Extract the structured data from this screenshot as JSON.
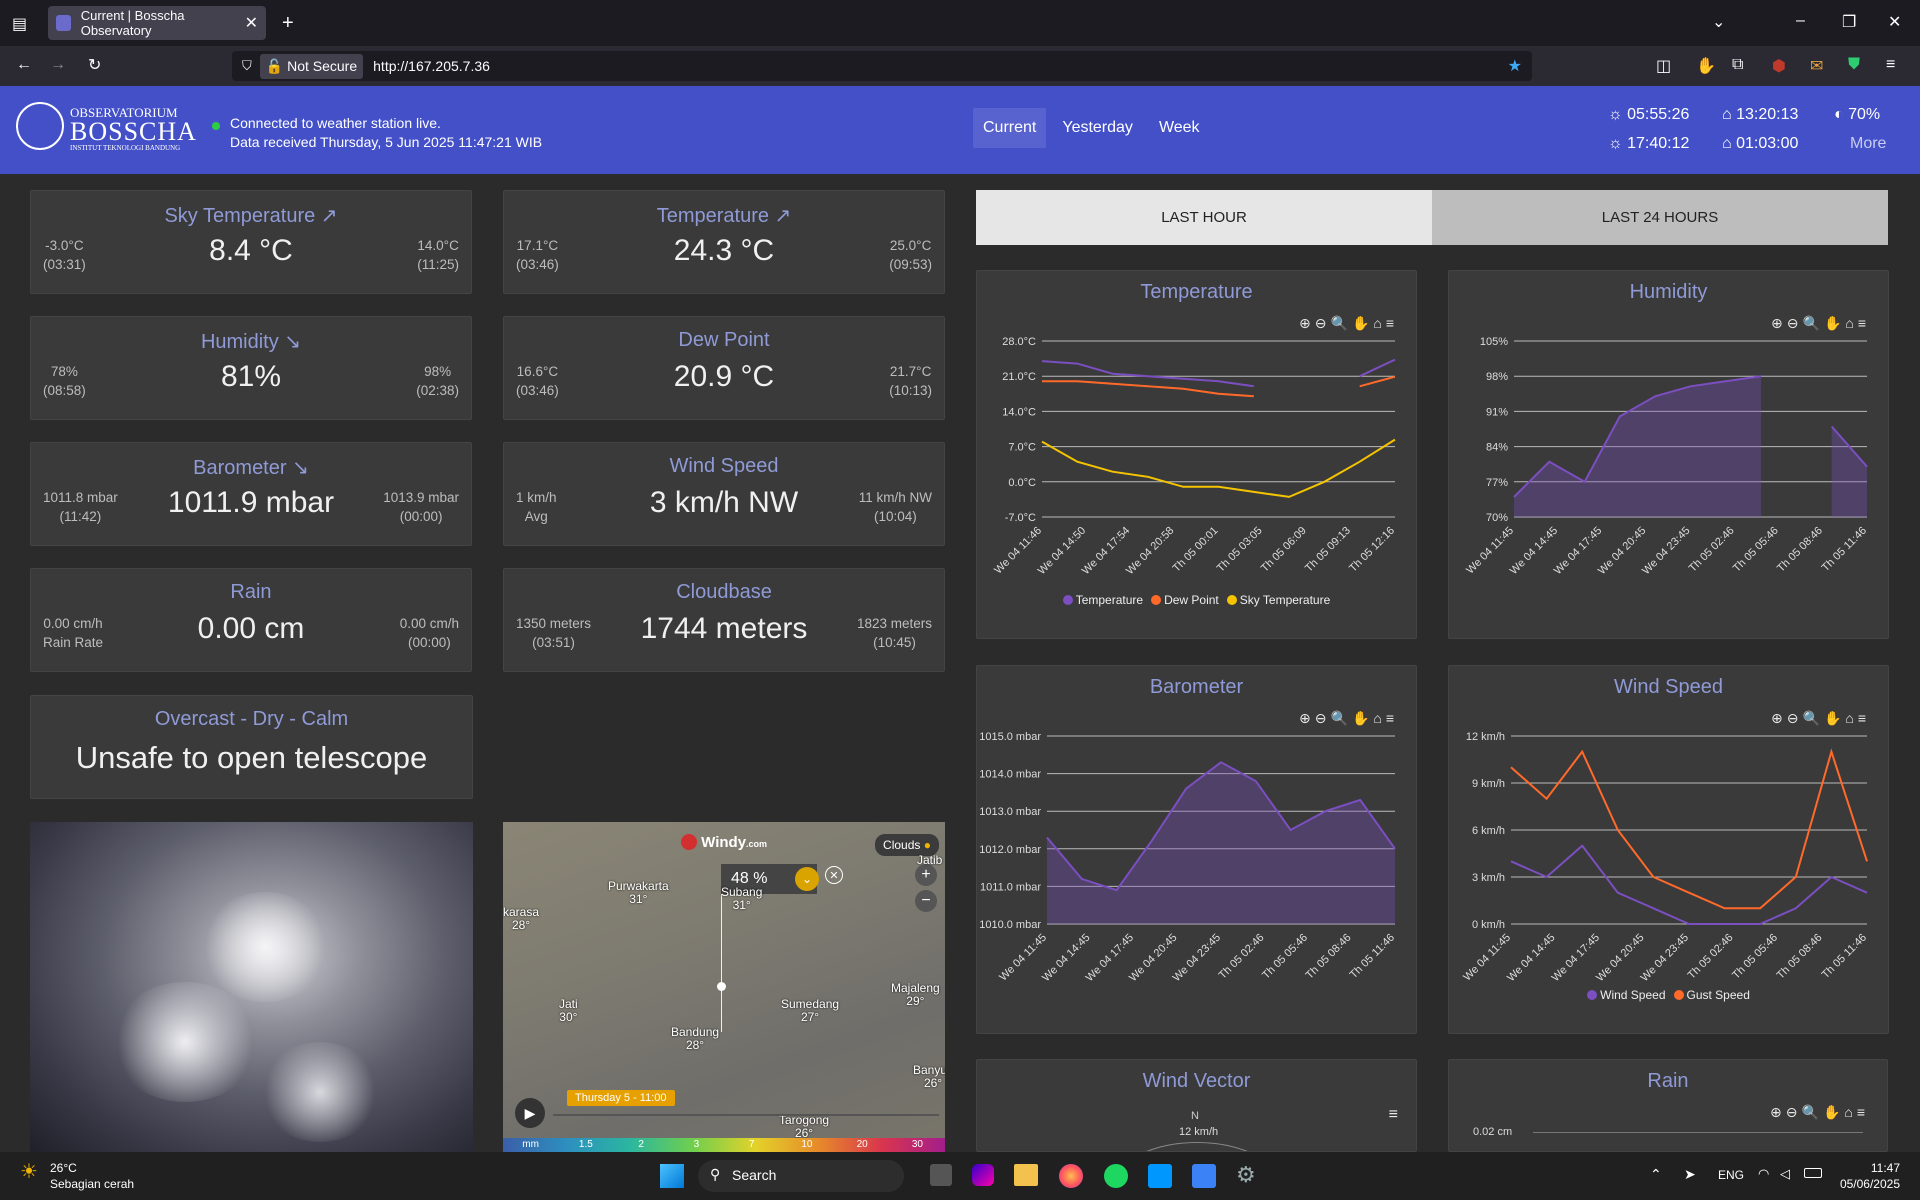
{
  "browser": {
    "tab_title": "Current | Bosscha Observatory",
    "url": "http://167.205.7.36",
    "not_secure": "Not Secure"
  },
  "header": {
    "logo_line1": "OBSERVATORIUM",
    "logo_line2": "BOSSCHA",
    "logo_line3": "INSTITUT TEKNOLOGI BANDUNG",
    "status_line1": "Connected to weather station live.",
    "status_line2": "Data received Thursday, 5 Jun 2025 11:47:21 WIB",
    "nav": [
      "Current",
      "Yesterday",
      "Week"
    ],
    "sunrise": "05:55:26",
    "sunset": "17:40:12",
    "moonrise": "13:20:13",
    "moonset": "01:03:00",
    "moon_pct": "70%",
    "more": "More"
  },
  "cards": [
    {
      "title": "Sky Temperature ↗",
      "value": "8.4 °C",
      "lo": "-3.0°C",
      "lo_time": "(03:31)",
      "hi": "14.0°C",
      "hi_time": "(11:25)"
    },
    {
      "title": "Temperature ↗",
      "value": "24.3 °C",
      "lo": "17.1°C",
      "lo_time": "(03:46)",
      "hi": "25.0°C",
      "hi_time": "(09:53)"
    },
    {
      "title": "Humidity ↘",
      "value": "81%",
      "lo": "78%",
      "lo_time": "(08:58)",
      "hi": "98%",
      "hi_time": "(02:38)"
    },
    {
      "title": "Dew Point",
      "value": "20.9 °C",
      "lo": "16.6°C",
      "lo_time": "(03:46)",
      "hi": "21.7°C",
      "hi_time": "(10:13)"
    },
    {
      "title": "Barometer ↘",
      "value": "1011.9 mbar",
      "lo": "1011.8 mbar",
      "lo_time": "(11:42)",
      "hi": "1013.9 mbar",
      "hi_time": "(00:00)"
    },
    {
      "title": "Wind Speed",
      "value": "3 km/h NW",
      "lo": "1 km/h",
      "lo_time": "Avg",
      "hi": "11 km/h NW",
      "hi_time": "(10:04)"
    },
    {
      "title": "Rain",
      "value": "0.00 cm",
      "lo": "0.00 cm/h",
      "lo_time": "Rain Rate",
      "hi": "0.00 cm/h",
      "hi_time": "(00:00)"
    },
    {
      "title": "Cloudbase",
      "value": "1744 meters",
      "lo": "1350 meters",
      "lo_time": "(03:51)",
      "hi": "1823 meters",
      "hi_time": "(10:45)"
    }
  ],
  "safety": {
    "title": "Overcast - Dry - Calm",
    "value": "Unsafe to open telescope"
  },
  "chart_tabs": [
    "LAST HOUR",
    "LAST 24 HOURS"
  ],
  "map": {
    "brand": "Windy",
    "brand_suffix": ".com",
    "layer": "Clouds",
    "cloud_pct": "48 %",
    "cloud_label": "Clouds",
    "time": "Thursday 5 - 11:00",
    "cities": [
      {
        "n": "Purwakarta",
        "t": "31°"
      },
      {
        "n": "Subang",
        "t": "31°"
      },
      {
        "n": "karasa",
        "t": "28°"
      },
      {
        "n": "Jati",
        "t": "30°"
      },
      {
        "n": "Bandung",
        "t": "28°"
      },
      {
        "n": "Sumedang",
        "t": "27°"
      },
      {
        "n": "Majaleng",
        "t": "29°"
      },
      {
        "n": "Banyus",
        "t": "26°"
      },
      {
        "n": "Tarogong",
        "t": "26°"
      },
      {
        "n": "Jatib",
        "t": ""
      }
    ],
    "scale": [
      "mm",
      "1.5",
      "2",
      "3",
      "7",
      "10",
      "20",
      "30"
    ]
  },
  "chart_data": [
    {
      "type": "line",
      "title": "Temperature",
      "ylim": [
        -7,
        28
      ],
      "yticks": [
        "28.0°C",
        "21.0°C",
        "14.0°C",
        "7.0°C",
        "0.0°C",
        "-7.0°C"
      ],
      "categories": [
        "We 04 11:46",
        "We 04 14:50",
        "We 04 17:54",
        "We 04 20:58",
        "Th 05 00:01",
        "Th 05 03:05",
        "Th 05 06:09",
        "Th 05 09:13",
        "Th 05 12:16"
      ],
      "series": [
        {
          "name": "Temperature",
          "color": "#7b4fc0",
          "values": [
            24,
            23.5,
            21.5,
            21,
            20.5,
            20,
            19,
            null,
            null,
            21,
            24.3
          ]
        },
        {
          "name": "Dew Point",
          "color": "#ff6a2b",
          "values": [
            20,
            20,
            19.5,
            19,
            18.5,
            17.5,
            17,
            null,
            null,
            19,
            20.9
          ]
        },
        {
          "name": "Sky Temperature",
          "color": "#f5c400",
          "values": [
            8,
            4,
            2,
            1,
            -1,
            -1,
            -2,
            -3,
            0,
            4,
            8.4
          ]
        }
      ]
    },
    {
      "type": "area",
      "title": "Humidity",
      "ylim": [
        70,
        105
      ],
      "yticks": [
        "105%",
        "98%",
        "91%",
        "84%",
        "77%",
        "70%"
      ],
      "categories": [
        "We 04 11:45",
        "We 04 14:45",
        "We 04 17:45",
        "We 04 20:45",
        "We 04 23:45",
        "Th 05 02:46",
        "Th 05 05:46",
        "Th 05 08:46",
        "Th 05 11:46"
      ],
      "series": [
        {
          "name": "Humidity",
          "color": "#7b4fc0",
          "values": [
            74,
            81,
            77,
            90,
            94,
            96,
            97,
            98,
            null,
            88,
            80
          ]
        }
      ]
    },
    {
      "type": "area",
      "title": "Barometer",
      "ylim": [
        1010,
        1015
      ],
      "yticks": [
        "1015.0 mbar",
        "1014.0 mbar",
        "1013.0 mbar",
        "1012.0 mbar",
        "1011.0 mbar",
        "1010.0 mbar"
      ],
      "categories": [
        "We 04 11:45",
        "We 04 14:45",
        "We 04 17:45",
        "We 04 20:45",
        "We 04 23:45",
        "Th 05 02:46",
        "Th 05 05:46",
        "Th 05 08:46",
        "Th 05 11:46"
      ],
      "series": [
        {
          "name": "Barometer",
          "color": "#7b4fc0",
          "values": [
            1012.3,
            1011.2,
            1010.9,
            1012.2,
            1013.6,
            1014.3,
            1013.8,
            1012.5,
            1013.0,
            1013.3,
            1012.0
          ]
        }
      ]
    },
    {
      "type": "line",
      "title": "Wind Speed",
      "ylim": [
        0,
        12
      ],
      "yticks": [
        "12 km/h",
        "9 km/h",
        "6 km/h",
        "3 km/h",
        "0 km/h"
      ],
      "categories": [
        "We 04 11:45",
        "We 04 14:45",
        "We 04 17:45",
        "We 04 20:45",
        "We 04 23:45",
        "Th 05 02:46",
        "Th 05 05:46",
        "Th 05 08:46",
        "Th 05 11:46"
      ],
      "series": [
        {
          "name": "Wind Speed",
          "color": "#7b4fc0",
          "values": [
            4,
            3,
            5,
            2,
            1,
            0,
            0,
            0,
            1,
            3,
            2
          ]
        },
        {
          "name": "Gust Speed",
          "color": "#ff6a2b",
          "values": [
            10,
            8,
            11,
            6,
            3,
            2,
            1,
            1,
            3,
            11,
            4
          ]
        }
      ]
    }
  ],
  "bottom_panels": {
    "wind_vector": "Wind Vector",
    "wind_n": "N",
    "wind_scale": "12 km/h",
    "rain": "Rain",
    "rain_tick": "0.02 cm"
  },
  "taskbar": {
    "weather_temp": "26°C",
    "weather_desc": "Sebagian cerah",
    "search": "Search",
    "lang": "ENG",
    "time": "11:47",
    "date": "05/06/2025"
  }
}
